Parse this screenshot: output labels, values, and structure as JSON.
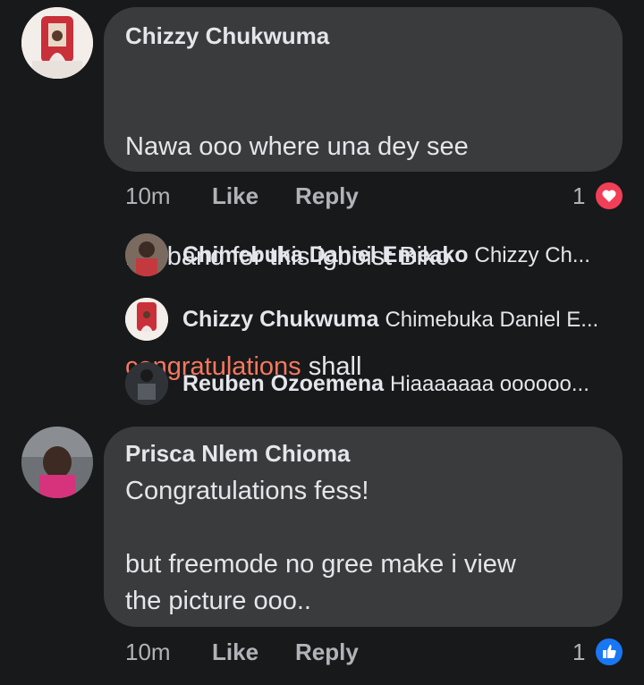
{
  "comments": [
    {
      "author": "Chizzy Chukwuma",
      "text_line1": "Nawa ooo where una dey see",
      "text_line2": "husband for this igboist Biko",
      "text_highlight": "congratulations",
      "text_after": " shall",
      "time": "10m",
      "like_label": "Like",
      "reply_label": "Reply",
      "reaction_count": "1",
      "reaction_icon": "heart-icon",
      "reaction_color": "#f33e58"
    },
    {
      "author": "Prisca Nlem Chioma",
      "text": "Congratulations fess!\n\nbut freemode no gree make i view\nthe picture ooo..",
      "time": "10m",
      "like_label": "Like",
      "reply_label": "Reply",
      "reaction_count": "1",
      "reaction_icon": "thumbs-up-icon",
      "reaction_color": "#1877f2"
    }
  ],
  "replies": [
    {
      "name": "Chimebuka Daniel Emeako",
      "snippet": "Chizzy Ch..."
    },
    {
      "name": "Chizzy Chukwuma",
      "snippet": "Chimebuka Daniel E..."
    },
    {
      "name": "Reuben Ozoemena",
      "snippet": "Hiaaaaaaa oooooo..."
    }
  ]
}
